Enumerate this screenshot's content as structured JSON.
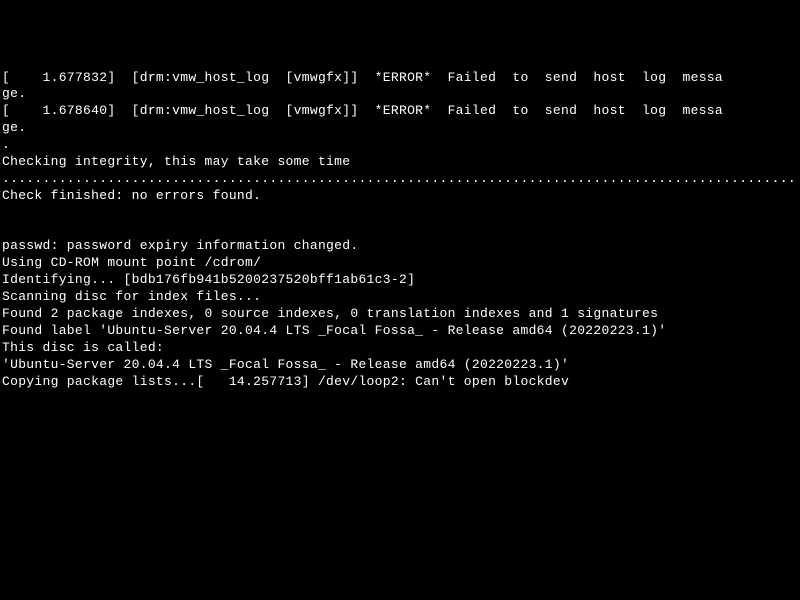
{
  "lines": [
    "[    1.677832]  [drm:vmw_host_log  [vmwgfx]]  *ERROR*  Failed  to  send  host  log  messa",
    "ge.",
    "[    1.678640]  [drm:vmw_host_log  [vmwgfx]]  *ERROR*  Failed  to  send  host  log  messa",
    "ge.",
    ".",
    "Checking integrity, this may take some time",
    "..................................................................................................",
    "Check finished: no errors found.",
    "",
    "",
    "passwd: password expiry information changed.",
    "Using CD-ROM mount point /cdrom/",
    "Identifying... [bdb176fb941b5200237520bff1ab61c3-2]",
    "Scanning disc for index files...",
    "Found 2 package indexes, 0 source indexes, 0 translation indexes and 1 signatures",
    "Found label 'Ubuntu-Server 20.04.4 LTS _Focal Fossa_ - Release amd64 (20220223.1)'",
    "This disc is called:",
    "'Ubuntu-Server 20.04.4 LTS _Focal Fossa_ - Release amd64 (20220223.1)'",
    "Copying package lists...[   14.257713] /dev/loop2: Can't open blockdev"
  ]
}
